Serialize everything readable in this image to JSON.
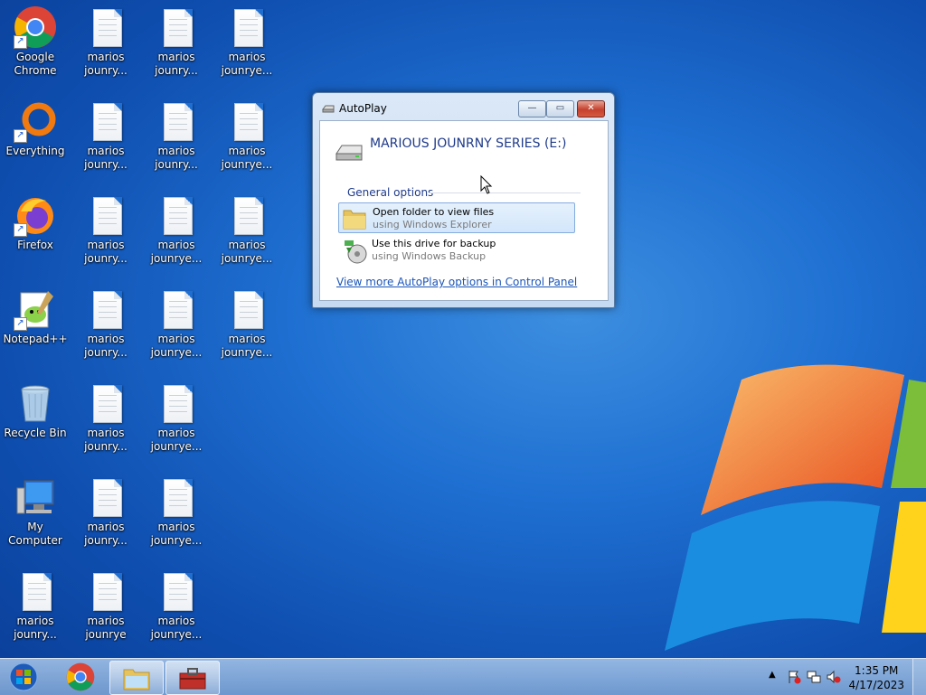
{
  "desktop": {
    "icons": [
      {
        "label": "Google\nChrome",
        "icon": "chrome-icon"
      },
      {
        "label": "Everything",
        "icon": "everything-icon"
      },
      {
        "label": "Firefox",
        "icon": "firefox-icon"
      },
      {
        "label": "Notepad++",
        "icon": "notepad-plus-plus-icon"
      },
      {
        "label": "Recycle Bin",
        "icon": "recycle-bin-icon"
      },
      {
        "label": "My Computer",
        "icon": "my-computer-icon"
      },
      {
        "label": "marios\njounry...",
        "icon": "text-file-icon"
      }
    ],
    "files_col2": [
      "marios\njounry...",
      "marios\njounry...",
      "marios\njounry...",
      "marios\njounry...",
      "marios\njounry...",
      "marios\njounry...",
      "marios\njounrye"
    ],
    "files_col3": [
      "marios\njounry...",
      "marios\njounry...",
      "marios\njounrye...",
      "marios\njounrye...",
      "marios\njounrye...",
      "marios\njounrye...",
      "marios\njounrye..."
    ],
    "files_col4": [
      "marios\njounrye...",
      "marios\njounrye...",
      "marios\njounrye...",
      "marios\njounrye..."
    ]
  },
  "autoplay": {
    "title": "AutoPlay",
    "drive_title": "MARIOUS JOUNRNY SERIES (E:)",
    "section": "General options",
    "options": [
      {
        "title": "Open folder to view files",
        "subtitle": "using Windows Explorer",
        "icon": "folder-icon",
        "selected": true
      },
      {
        "title": "Use this drive for backup",
        "subtitle": "using Windows Backup",
        "icon": "backup-icon",
        "selected": false
      }
    ],
    "link": "View more AutoPlay options in Control Panel",
    "buttons": {
      "minimize": "—",
      "maximize": "▭",
      "close": "✕"
    }
  },
  "taskbar": {
    "pinned": [
      "start-orb-icon",
      "chrome-icon",
      "explorer-icon",
      "toolbox-icon"
    ],
    "clock": {
      "time": "1:35 PM",
      "date": "4/17/2023"
    },
    "tray_icons": [
      "show-hidden-icons-arrow",
      "action-center-flag-icon",
      "network-icon",
      "volume-muted-icon"
    ]
  },
  "colors": {
    "accent": "#1e6fd1",
    "link": "#1a55b8",
    "heading": "#1e3a8a"
  }
}
